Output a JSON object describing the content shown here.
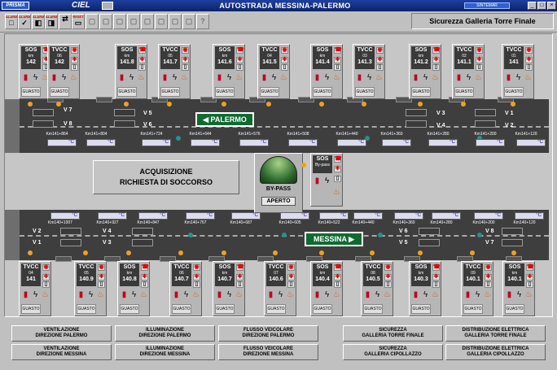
{
  "titlebar": {
    "logo": "PRISMA",
    "app": "CIEL",
    "title": "AUTOSTRADA MESSINA-PALERMO",
    "brand": "SINTEMAR"
  },
  "toolbar": {
    "buttons": [
      {
        "label": "ALARM",
        "icon": "□"
      },
      {
        "label": "ALARM",
        "icon": "✓"
      },
      {
        "label": "ALARM",
        "icon": "◧"
      },
      {
        "label": "ALARM",
        "icon": "◨"
      },
      {
        "label": "",
        "icon": "⇄"
      },
      {
        "label": "RESET",
        "icon": "▭"
      }
    ],
    "page_label": "Sicurezza Galleria Torre Finale"
  },
  "top": {
    "stations": [
      {
        "t": "SOS",
        "s": "km",
        "v": "142"
      },
      {
        "t": "TVCC",
        "s": "06",
        "v": "142"
      },
      {
        "t": "SOS",
        "s": "km",
        "v": "141.8"
      },
      {
        "t": "TVCC",
        "s": "05",
        "v": "141.7"
      },
      {
        "t": "SOS",
        "s": "km",
        "v": "141.6"
      },
      {
        "t": "TVCC",
        "s": "04",
        "v": "141.5"
      },
      {
        "t": "SOS",
        "s": "km",
        "v": "141.4"
      },
      {
        "t": "TVCC",
        "s": "03",
        "v": "141.3"
      },
      {
        "t": "SOS",
        "s": "km",
        "v": "141.2"
      },
      {
        "t": "TVCC",
        "s": "02",
        "v": "141.1"
      },
      {
        "t": "TVCC",
        "s": "01",
        "v": "141"
      }
    ],
    "km": [
      "Km141+864",
      "Km141+804",
      "Km141+724",
      "Km141+644",
      "Km141+576",
      "Km141+508",
      "Km141+440",
      "Km141+360",
      "Km141+280",
      "Km141+200",
      "Km141+120"
    ],
    "v": [
      {
        "n": "V 7"
      },
      {
        "n": "V 8"
      },
      {
        "n": "V 5"
      },
      {
        "n": "V 6"
      },
      {
        "n": "V 3"
      },
      {
        "n": "V 4"
      },
      {
        "n": "V 1"
      },
      {
        "n": "V 2"
      }
    ],
    "sign": "PALERMO"
  },
  "bottom": {
    "stations": [
      {
        "t": "TVCC",
        "s": "04",
        "v": "141"
      },
      {
        "t": "TVCC",
        "s": "05",
        "v": "140.9"
      },
      {
        "t": "SOS",
        "s": "km",
        "v": "140.8"
      },
      {
        "t": "TVCC",
        "s": "06",
        "v": "140.7"
      },
      {
        "t": "SOS",
        "s": "km",
        "v": "140.7"
      },
      {
        "t": "TVCC",
        "s": "07",
        "v": "140.6"
      },
      {
        "t": "SOS",
        "s": "km",
        "v": "140.4"
      },
      {
        "t": "TVCC",
        "s": "08",
        "v": "140.5"
      },
      {
        "t": "SOS",
        "s": "km",
        "v": "140.3"
      },
      {
        "t": "TVCC",
        "s": "09",
        "v": "140.1"
      },
      {
        "t": "SOS",
        "s": "km",
        "v": "140.1"
      }
    ],
    "km": [
      "Km140+1007",
      "Km140+927",
      "Km140+847",
      "Km140+767",
      "Km140+687",
      "Km140+605",
      "Km140+522",
      "Km140+440",
      "Km140+360",
      "Km140+280",
      "Km140+200",
      "Km140+120"
    ],
    "v": [
      {
        "n": "V 2"
      },
      {
        "n": "V 1"
      },
      {
        "n": "V 4"
      },
      {
        "n": "V 3"
      },
      {
        "n": "V 6"
      },
      {
        "n": "V 5"
      },
      {
        "n": "V 8"
      },
      {
        "n": "V 7"
      }
    ],
    "sign": "MESSINA"
  },
  "temp_unit": "°C",
  "guasto": "GUASTO",
  "acquisizione": {
    "l1": "ACQUISIZIONE",
    "l2": "RICHIESTA DI SOCCORSO"
  },
  "bypass": {
    "label": "BY-PASS",
    "status": "APERTO",
    "sos": "SOS",
    "sos_sub": "By-pass"
  },
  "footer": [
    {
      "l1": "VENTILAZIONE",
      "l2": "DIREZIONE PALERMO"
    },
    {
      "l1": "ILLUMINAZIONE",
      "l2": "DIREZIONE PALERMO"
    },
    {
      "l1": "FLUSSO VEICOLARE",
      "l2": "DIREZIONE PALERMO"
    },
    {
      "l1": "SICUREZZA",
      "l2": "GALLERIA TORRE FINALE"
    },
    {
      "l1": "DISTRIBUZIONE ELETTRICA",
      "l2": "GALLERIA TORRE FINALE"
    },
    {
      "l1": "VENTILAZIONE",
      "l2": "DIREZIONE MESSINA"
    },
    {
      "l1": "ILLUMINAZIONE",
      "l2": "DIREZIONE MESSINA"
    },
    {
      "l1": "FLUSSO VEICOLARE",
      "l2": "DIREZIONE MESSINA"
    },
    {
      "l1": "SICUREZZA",
      "l2": "GALLERIA CIPOLLAZZO"
    },
    {
      "l1": "DISTRIBUZIONE ELETTRICA",
      "l2": "GALLERIA CIPOLLAZZO"
    }
  ]
}
